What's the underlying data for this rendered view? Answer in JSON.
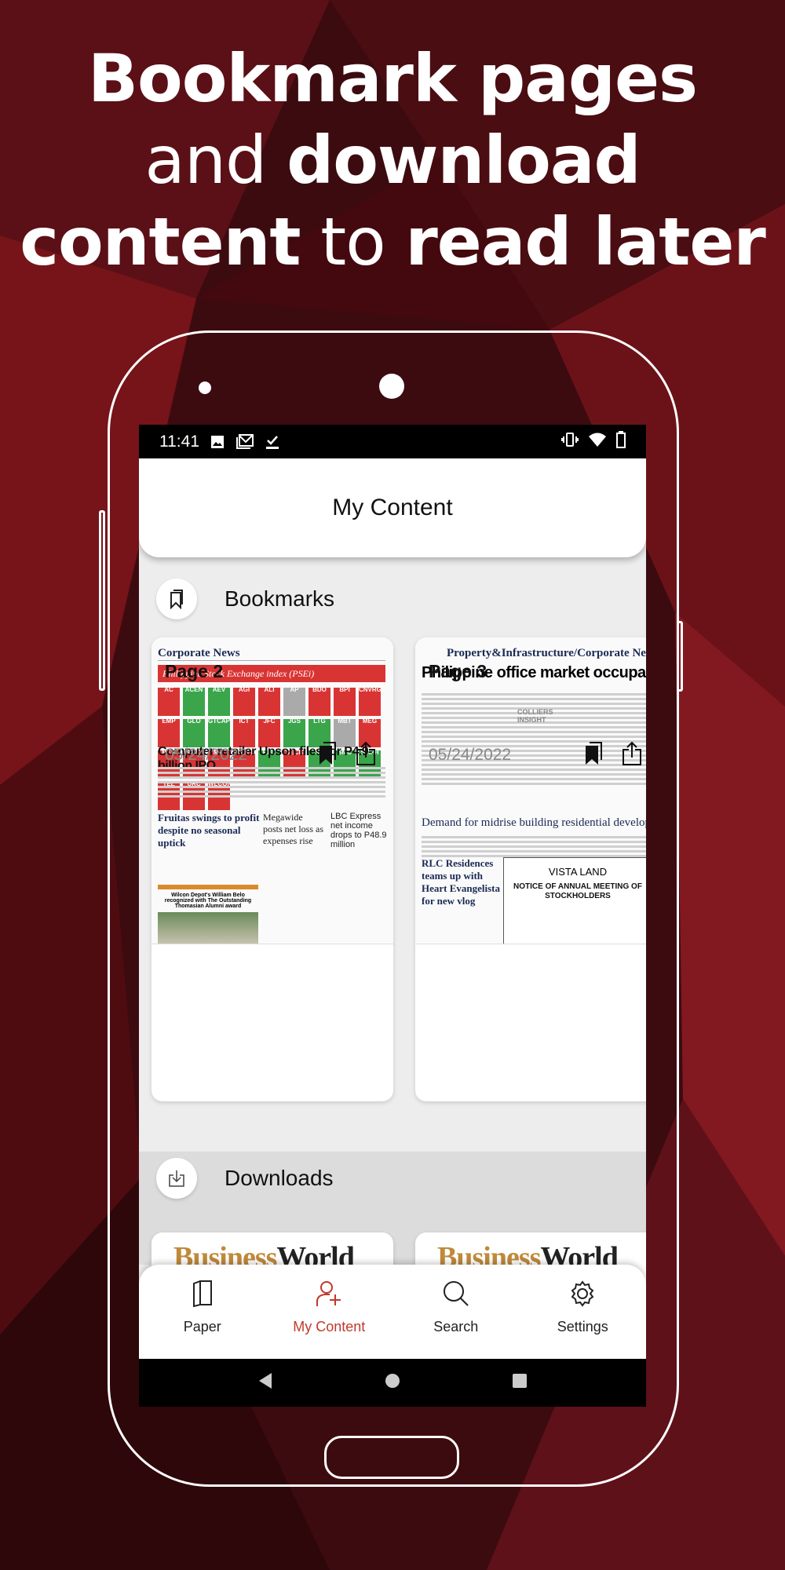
{
  "promo": {
    "line1_bold": "Bookmark pages",
    "line2_light": "and",
    "line2_bold": "download",
    "line3_bold1": "content",
    "line3_light": "to",
    "line3_bold2": "read later"
  },
  "status_bar": {
    "time": "11:41",
    "left_icons": [
      "image-icon",
      "gmail-icon",
      "download-done-icon"
    ],
    "right_icons": [
      "vibrate-icon",
      "wifi-icon",
      "battery-icon"
    ]
  },
  "header": {
    "title": "My Content"
  },
  "bookmarks": {
    "title": "Bookmarks",
    "items": [
      {
        "page": "Page 2",
        "date": "05/24/2022",
        "section": "Corporate News",
        "banner": "Philippine Stock Exchange index (PSEi)",
        "headline": "Computer retailer Upson files for P4.9-billion IPO",
        "sub1": "Fruitas swings to profit despite no seasonal uptick",
        "sub2": "Megawide posts net loss as expenses rise",
        "sub3": "LBC Express net income drops to P48.9 million",
        "sub4": "Wilcon Depot's William Belo recognized with The Outstanding Thomasian Alumni award",
        "tiles": [
          "AC",
          "ACEN",
          "AEV",
          "AGI",
          "ALI",
          "AP",
          "BDO",
          "BPI",
          "CNVRG",
          "EMP",
          "GLO",
          "GTCAP",
          "ICT",
          "JFC",
          "JGS",
          "LTG",
          "MBT",
          "MEG",
          "MER",
          "MONDE",
          "MPI",
          "PGOLD",
          "RLC",
          "SECB",
          "SM",
          "SMC",
          "SMPH",
          "TEL",
          "URC",
          "WLCON"
        ]
      },
      {
        "page": "Page 3",
        "date": "05/24/2022",
        "section": "Property&Infrastructure/Corporate News",
        "headline": "Philippine office market occupancy stabilize",
        "sub1": "Demand for midrise building residential developments growing in key citi",
        "sub2": "RLC Residences teams up with Heart Evangelista for new vlog",
        "ad_brand": "VISTA LAND",
        "ad_title": "NOTICE OF ANNUAL MEETING OF STOCKHOLDERS",
        "insight": "COLLIERS INSIGHT"
      }
    ]
  },
  "downloads": {
    "title": "Downloads",
    "items": [
      {
        "masthead_a": "Business",
        "masthead_b": "World"
      },
      {
        "masthead_a": "Business",
        "masthead_b": "World"
      }
    ]
  },
  "bottom_nav": {
    "active": "My Content",
    "accent": "#c0392b",
    "items": [
      {
        "label": "Paper",
        "icon": "paper-icon"
      },
      {
        "label": "My Content",
        "icon": "user-add-icon"
      },
      {
        "label": "Search",
        "icon": "search-icon"
      },
      {
        "label": "Settings",
        "icon": "gear-icon"
      }
    ]
  }
}
